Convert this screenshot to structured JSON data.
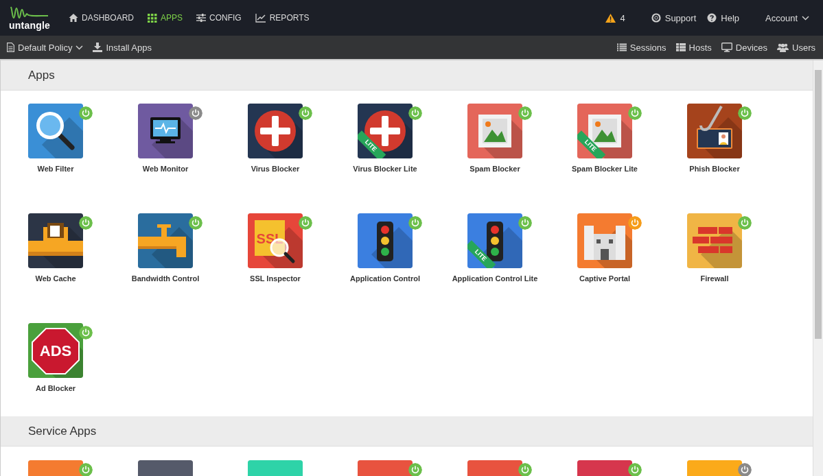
{
  "header": {
    "logo": {
      "text": "untangle"
    },
    "nav": [
      {
        "label": "DASHBOARD",
        "kind": "home",
        "selected": false
      },
      {
        "label": "APPS",
        "kind": "grid",
        "selected": true
      },
      {
        "label": "CONFIG",
        "kind": "sliders",
        "selected": false
      },
      {
        "label": "REPORTS",
        "kind": "chart",
        "selected": false
      }
    ],
    "alerts": {
      "count": "4"
    },
    "links": [
      {
        "label": "Support",
        "kind": "lifebuoy"
      },
      {
        "label": "Help",
        "kind": "question"
      }
    ],
    "account": {
      "label": "Account"
    }
  },
  "toolbar": {
    "policy": {
      "label": "Default Policy"
    },
    "install": {
      "label": "Install Apps"
    },
    "right": [
      {
        "label": "Sessions",
        "kind": "list"
      },
      {
        "label": "Hosts",
        "kind": "table"
      },
      {
        "label": "Devices",
        "kind": "monitor"
      },
      {
        "label": "Users",
        "kind": "users"
      }
    ]
  },
  "sections": [
    {
      "title": "Apps",
      "apps": [
        {
          "name": "Web Filter",
          "kind": "magnifier",
          "color": "#3a8fd6",
          "power_badge": true,
          "enabled": true,
          "pending": false
        },
        {
          "name": "Web Monitor",
          "kind": "monitor",
          "color": "#6f5aa0",
          "power_badge": true,
          "enabled": false,
          "pending": false
        },
        {
          "name": "Virus Blocker",
          "kind": "cross",
          "color": "#243652",
          "power_badge": true,
          "enabled": true,
          "pending": false
        },
        {
          "name": "Virus Blocker Lite",
          "kind": "cross",
          "color": "#243652",
          "power_badge": true,
          "enabled": true,
          "pending": false,
          "ribbon": "LITE"
        },
        {
          "name": "Spam Blocker",
          "kind": "stamp",
          "color": "#e4665a",
          "power_badge": true,
          "enabled": true,
          "pending": false
        },
        {
          "name": "Spam Blocker Lite",
          "kind": "stamp",
          "color": "#e4665a",
          "power_badge": true,
          "enabled": true,
          "pending": false,
          "ribbon": "LITE"
        },
        {
          "name": "Phish Blocker",
          "kind": "hook",
          "color": "#a5431c",
          "power_badge": true,
          "enabled": true,
          "pending": false
        },
        {
          "name": "Web Cache",
          "kind": "cache",
          "color": "#2c3546",
          "power_badge": true,
          "enabled": true,
          "pending": false
        },
        {
          "name": "Bandwidth Control",
          "kind": "pipe",
          "color": "#2a6d9e",
          "power_badge": true,
          "enabled": true,
          "pending": false
        },
        {
          "name": "SSL Inspector",
          "kind": "ssl",
          "color": "#e6463a",
          "power_badge": true,
          "enabled": true,
          "pending": false,
          "icon_text": "SSL"
        },
        {
          "name": "Application Control",
          "kind": "traffic",
          "color": "#3b7fe0",
          "power_badge": true,
          "enabled": true,
          "pending": false
        },
        {
          "name": "Application Control Lite",
          "kind": "traffic",
          "color": "#3b7fe0",
          "power_badge": true,
          "enabled": true,
          "pending": false,
          "ribbon": "LITE"
        },
        {
          "name": "Captive Portal",
          "kind": "castle",
          "color": "#f47b30",
          "power_badge": true,
          "enabled": true,
          "pending": true
        },
        {
          "name": "Firewall",
          "kind": "bricks",
          "color": "#f0b545",
          "power_badge": true,
          "enabled": true,
          "pending": false
        },
        {
          "name": "Ad Blocker",
          "kind": "ads",
          "color": "#4aa03c",
          "power_badge": true,
          "enabled": true,
          "pending": false,
          "icon_text": "ADS"
        }
      ]
    },
    {
      "title": "Service Apps",
      "apps": [
        {
          "kind": "blank",
          "color": "#f47b30",
          "power_badge": true,
          "enabled": true,
          "pending": false
        },
        {
          "kind": "blank",
          "color": "#555a6a",
          "power_badge": false
        },
        {
          "kind": "blank",
          "color": "#2ed3a8",
          "power_badge": false
        },
        {
          "kind": "blank",
          "color": "#e8533f",
          "power_badge": true,
          "enabled": true,
          "pending": false
        },
        {
          "kind": "blank",
          "color": "#e8533f",
          "power_badge": true,
          "enabled": true,
          "pending": false
        },
        {
          "kind": "blank",
          "color": "#d6364d",
          "power_badge": true,
          "enabled": true,
          "pending": false
        },
        {
          "kind": "blank",
          "color": "#fbaa1a",
          "power_badge": true,
          "enabled": false,
          "pending": false
        }
      ]
    }
  ]
}
